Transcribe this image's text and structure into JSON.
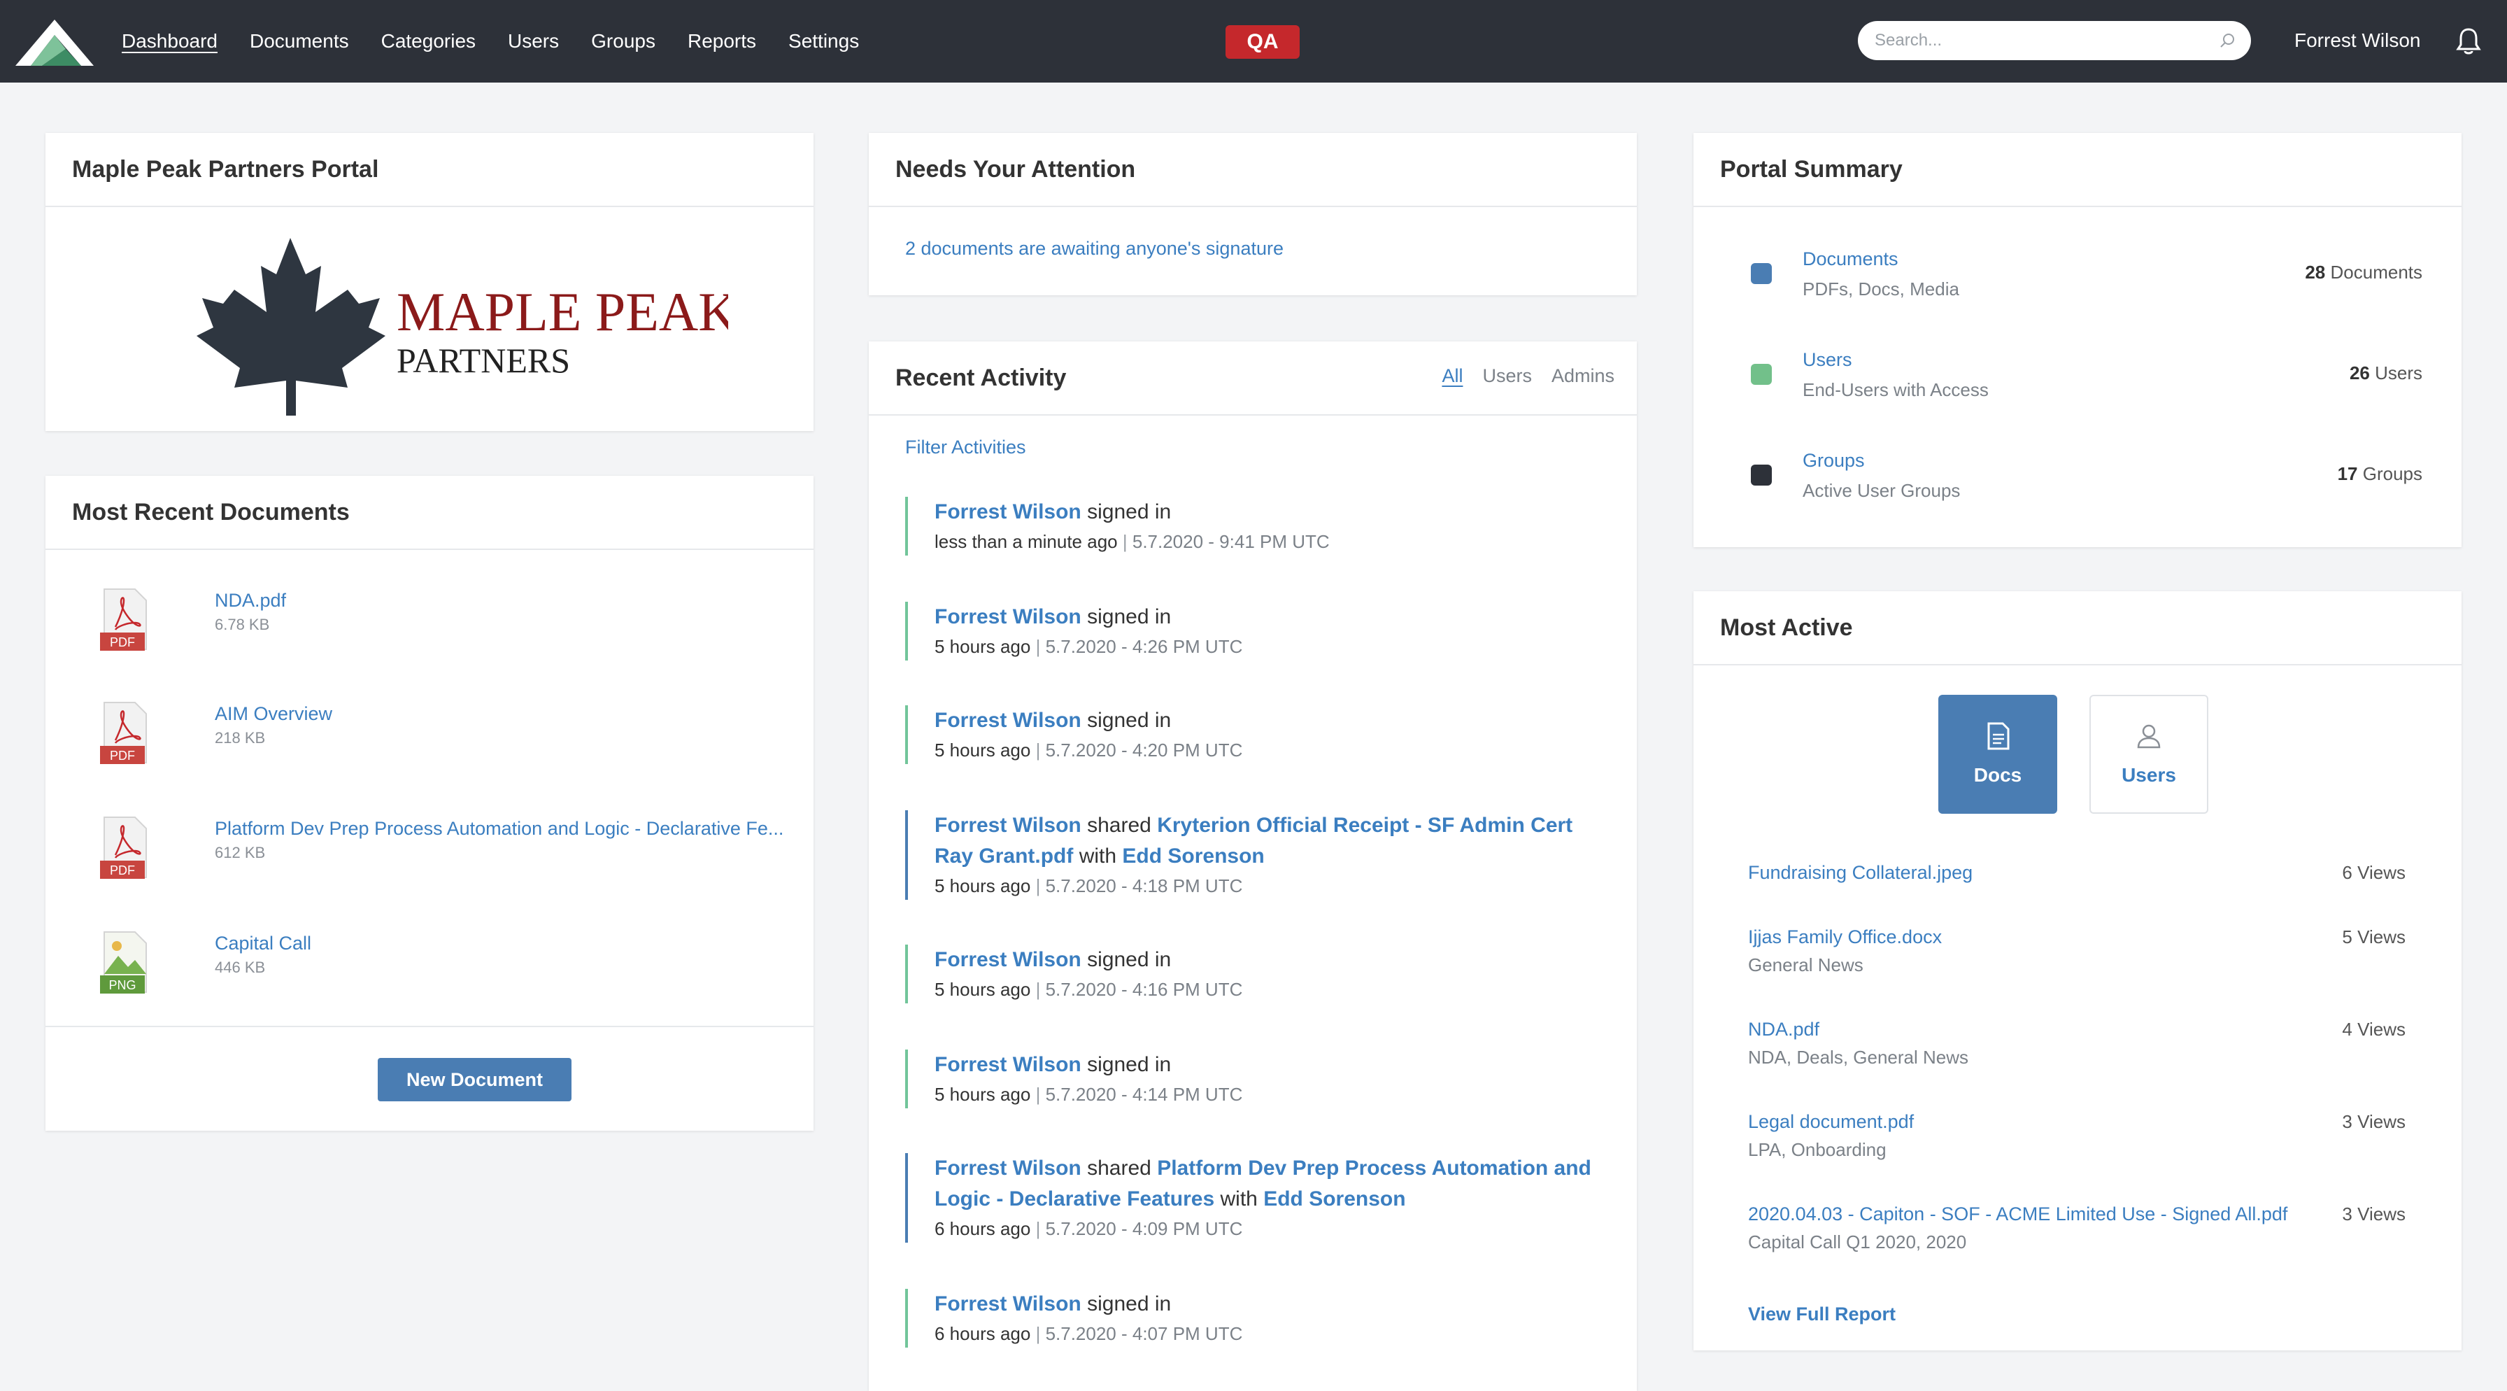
{
  "nav": {
    "items": [
      "Dashboard",
      "Documents",
      "Categories",
      "Users",
      "Groups",
      "Reports",
      "Settings"
    ],
    "active": "Dashboard",
    "badge": "QA",
    "search_placeholder": "Search...",
    "user": "Forrest Wilson"
  },
  "portal": {
    "title": "Maple Peak Partners Portal",
    "logo_text_line1": "MAPLE PEAK",
    "logo_text_line2": "PARTNERS"
  },
  "recent_docs": {
    "title": "Most Recent Documents",
    "items": [
      {
        "name": "NDA.pdf",
        "size": "6.78 KB",
        "type": "PDF"
      },
      {
        "name": "AIM Overview",
        "size": "218 KB",
        "type": "PDF"
      },
      {
        "name": "Platform Dev Prep Process Automation and Logic - Declarative Fe...",
        "size": "612 KB",
        "type": "PDF"
      },
      {
        "name": "Capital Call",
        "size": "446 KB",
        "type": "PNG"
      }
    ],
    "new_button": "New Document"
  },
  "attention": {
    "title": "Needs Your Attention",
    "message": "2 documents are awaiting anyone's signature"
  },
  "activity": {
    "title": "Recent Activity",
    "tabs": [
      "All",
      "Users",
      "Admins"
    ],
    "active_tab": "All",
    "filter_label": "Filter Activities",
    "items": [
      {
        "user": "Forrest Wilson",
        "action": "signed in",
        "ago": "less than a minute ago",
        "ts": "5.7.2020 - 9:41 PM UTC"
      },
      {
        "user": "Forrest Wilson",
        "action": "signed in",
        "ago": "5 hours ago",
        "ts": "5.7.2020 - 4:26 PM UTC"
      },
      {
        "user": "Forrest Wilson",
        "action": "signed in",
        "ago": "5 hours ago",
        "ts": "5.7.2020 - 4:20 PM UTC"
      },
      {
        "user": "Forrest Wilson",
        "action": "shared",
        "doc": "Kryterion Official Receipt - SF Admin Cert Ray Grant.pdf",
        "with_word": "with",
        "target": "Edd Sorenson",
        "ago": "5 hours ago",
        "ts": "5.7.2020 - 4:18 PM UTC"
      },
      {
        "user": "Forrest Wilson",
        "action": "signed in",
        "ago": "5 hours ago",
        "ts": "5.7.2020 - 4:16 PM UTC"
      },
      {
        "user": "Forrest Wilson",
        "action": "signed in",
        "ago": "5 hours ago",
        "ts": "5.7.2020 - 4:14 PM UTC"
      },
      {
        "user": "Forrest Wilson",
        "action": "shared",
        "doc": "Platform Dev Prep Process Automation and Logic - Declarative Features",
        "with_word": "with",
        "target": "Edd Sorenson",
        "ago": "6 hours ago",
        "ts": "5.7.2020 - 4:09 PM UTC"
      },
      {
        "user": "Forrest Wilson",
        "action": "signed in",
        "ago": "6 hours ago",
        "ts": "5.7.2020 - 4:07 PM UTC"
      }
    ]
  },
  "summary": {
    "title": "Portal Summary",
    "items": [
      {
        "title": "Documents",
        "sub": "PDFs, Docs, Media",
        "count": "28",
        "unit": "Documents",
        "color": "#4a7db3"
      },
      {
        "title": "Users",
        "sub": "End-Users with Access",
        "count": "26",
        "unit": "Users",
        "color": "#72c08a"
      },
      {
        "title": "Groups",
        "sub": "Active User Groups",
        "count": "17",
        "unit": "Groups",
        "color": "#2d3139"
      }
    ]
  },
  "most_active": {
    "title": "Most Active",
    "toggle_docs": "Docs",
    "toggle_users": "Users",
    "items": [
      {
        "name": "Fundraising Collateral.jpeg",
        "sub": "",
        "views": "6 Views"
      },
      {
        "name": "Ijjas Family Office.docx",
        "sub": "General News",
        "views": "5 Views"
      },
      {
        "name": "NDA.pdf",
        "sub": "NDA, Deals, General News",
        "views": "4 Views"
      },
      {
        "name": "Legal document.pdf",
        "sub": "LPA, Onboarding",
        "views": "3 Views"
      },
      {
        "name": "2020.04.03 - Capiton - SOF - ACME Limited Use - Signed All.pdf",
        "sub": "Capital Call Q1 2020, 2020",
        "views": "3 Views"
      }
    ],
    "full_report": "View Full Report"
  },
  "colors": {
    "topbar": "#2d3139",
    "link": "#3b7ec0",
    "primary": "#4a7db3",
    "badge": "#c5282c",
    "activity_signin": "#72c59a",
    "maple_red": "#8b1a1a"
  },
  "icons": [
    "app-logo-icon",
    "search-icon",
    "bell-icon",
    "pdf-file-icon",
    "png-file-icon",
    "document-icon",
    "user-icon",
    "maple-leaf-icon"
  ]
}
